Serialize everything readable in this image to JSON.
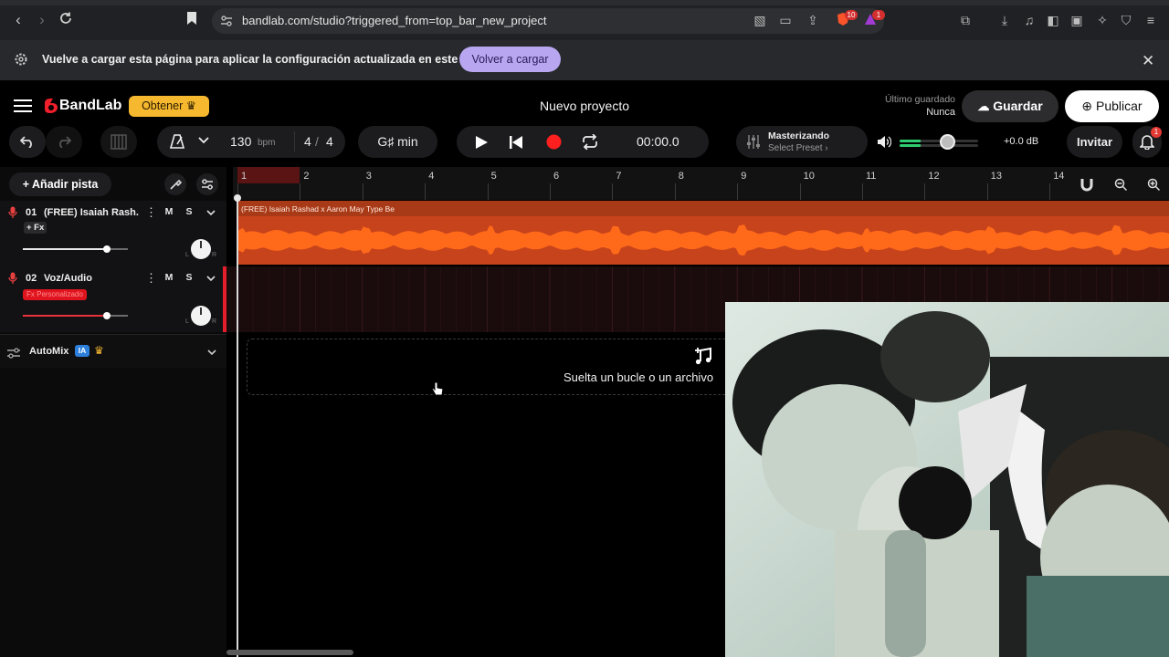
{
  "browser": {
    "url": "bandlab.com/studio?triggered_from=top_bar_new_project",
    "badge_brave": "10",
    "badge_alert": "1"
  },
  "infobar": {
    "message": "Vuelve a cargar esta página para aplicar la configuración actualizada en este sitio",
    "reload_label": "Volver a cargar"
  },
  "header": {
    "logo": "BandLab",
    "get_label": "Obtener",
    "project_title": "Nuevo proyecto",
    "last_saved_label": "Último guardado",
    "last_saved_value": "Nunca",
    "save_label": "Guardar",
    "publish_label": "Publicar"
  },
  "toolbar": {
    "bpm": "130",
    "bpm_unit": "bpm",
    "time_sig_num": "4",
    "time_sig_sep": "/",
    "time_sig_den": "4",
    "key": "G♯ min",
    "time": "00:00.0",
    "mastering_label": "Masterizando",
    "mastering_preset": "Select Preset",
    "master_volume": 0.6,
    "db": "+0.0 dB",
    "invite_label": "Invitar",
    "notif_count": "1"
  },
  "tracks_panel": {
    "add_track_label": "Añadir pista",
    "tracks": [
      {
        "number": "01",
        "name": "(FREE) Isaiah Rash...",
        "fx_label": "+ Fx",
        "mute": "M",
        "solo": "S",
        "volume": 0.8,
        "pan_l": "L",
        "pan_r": "R"
      },
      {
        "number": "02",
        "name": "Voz/Audio",
        "fx_label": "Fx Personalizado",
        "mute": "M",
        "solo": "S",
        "volume": 0.8,
        "pan_l": "L",
        "pan_r": "R"
      }
    ],
    "automix_label": "AutoMix",
    "automix_badge": "IA"
  },
  "arrangement": {
    "ruler": [
      "1",
      "2",
      "3",
      "4",
      "5",
      "6",
      "7",
      "8",
      "9",
      "10",
      "11",
      "12",
      "13",
      "14"
    ],
    "clip_title": "(FREE) Isaiah Rashad x Aaron May Type Be",
    "drop_text": "Suelta un bucle o un archivo"
  },
  "colors": {
    "accent_purple": "#b8a7f0",
    "gold": "#f5b82e",
    "clip_orange": "#e4561f",
    "record_red": "#ff1f1f"
  }
}
